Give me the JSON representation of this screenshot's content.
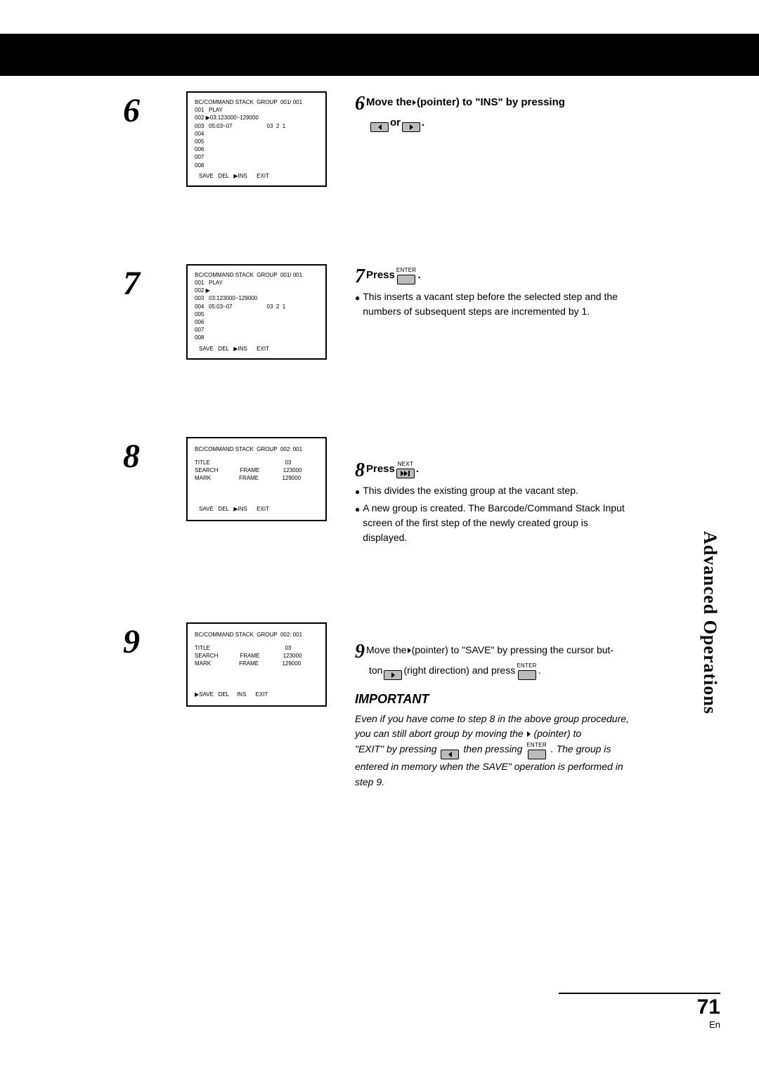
{
  "side_tab": "Advanced Operations",
  "page_number": "71",
  "page_lang": "En",
  "buttons": {
    "enter": "ENTER",
    "next": "NEXT"
  },
  "step6": {
    "num": "6",
    "screen": {
      "header": "BC/COMMAND STACK  GROUP  001/ 001",
      "lines": [
        "001   PLAY",
        "002 ▶03:123000~129000",
        "003   05:03~07                      03  2  1",
        "004",
        "005",
        "006",
        "007",
        "008"
      ],
      "footer": "SAVE   DEL   ▶INS      EXIT"
    },
    "lead_a": "Move the ",
    "lead_b": " (pointer) to \"INS\" by pressing",
    "lead_or": " or ",
    "period": "."
  },
  "step7": {
    "num": "7",
    "screen": {
      "header": "BC/COMMAND STACK  GROUP  001/ 001",
      "lines": [
        "001   PLAY",
        "002 ▶",
        "003   03:123000~129000",
        "004   05:03~07                      03  2  1",
        "005",
        "006",
        "007",
        "008"
      ],
      "footer": "SAVE   DEL   ▶INS      EXIT"
    },
    "lead": "Press ",
    "period": ".",
    "bullet": "This inserts a vacant step before the selected step and the numbers of subsequent steps are incremented by 1."
  },
  "step8": {
    "num": "8",
    "screen": {
      "header": "BC/COMMAND STACK  GROUP  002: 001",
      "rows": [
        "TITLE                                                03",
        "SEARCH              FRAME               123000",
        "MARK                  FRAME               129000"
      ],
      "footer": "SAVE   DEL   ▶INS      EXIT"
    },
    "lead": "Press ",
    "period": ".",
    "bullets": [
      "This divides the existing group at the vacant step.",
      "A new group is created. The Barcode/Command Stack Input screen of the first step of the newly created group is displayed."
    ]
  },
  "step9": {
    "num": "9",
    "screen": {
      "header": "BC/COMMAND STACK  GROUP  002: 001",
      "rows": [
        "TITLE                                                03",
        "SEARCH              FRAME               123000",
        "MARK                  FRAME               129000"
      ],
      "footer": "▶SAVE   DEL     INS      EXIT"
    },
    "lead_a": "Move the ",
    "lead_b": " (pointer) to \"SAVE\" by pressing the cursor but-",
    "lead_c": "ton ",
    "lead_d": " (right direction) and press ",
    "period": ".",
    "important_head": "IMPORTANT",
    "important_1": "Even if you have come to step 8 in the above group procedure, you can still abort group by moving the ",
    "important_1b": " (pointer) to",
    "important_2a": "\"EXIT\" by pressing ",
    "important_2b": " then pressing ",
    "important_2c": ". The group is entered in memory when the SAVE\" operation is performed in step  9."
  }
}
